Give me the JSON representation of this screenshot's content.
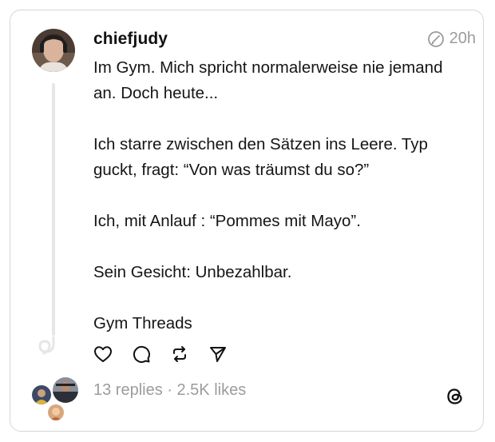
{
  "post": {
    "username": "chiefjudy",
    "time": "20h",
    "paragraphs": [
      "Im Gym. Mich spricht normalerweise nie jemand an. Doch heute...",
      "Ich starre zwischen den Sätzen ins Leere. Typ guckt, fragt: “Von was träumst du so?”",
      "Ich, mit Anlauf : “Pommes mit Mayo”.",
      "Sein Gesicht: Unbezahlbar.",
      "Gym Threads"
    ],
    "stats": "13 replies · 2.5K likes"
  },
  "icons": {
    "avatar": "user-avatar",
    "edited": "edited-icon",
    "like": "heart-icon",
    "comment": "comment-icon",
    "repost": "repost-icon",
    "share": "send-icon",
    "brand": "threads-logo-icon"
  },
  "colors": {
    "text": "#151515",
    "muted": "#9b9b9b",
    "border": "#d6d6d6",
    "thread_line": "#e6e6e6"
  }
}
